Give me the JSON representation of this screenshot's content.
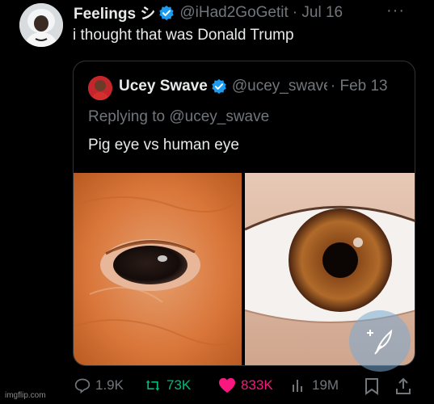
{
  "tweet": {
    "display_name": "Feelings シ",
    "handle": "@iHad2GoGetit",
    "date": "· Jul 16",
    "more_label": "···",
    "text": "i thought that was Donald Trump"
  },
  "quoted": {
    "display_name": "Ucey Swave",
    "handle": "@ucey_swave",
    "date": "· Feb 13",
    "replying_to": "Replying to @ucey_swave",
    "text": "Pig eye vs human eye",
    "images": [
      {
        "icon": "pig-eye-photo"
      },
      {
        "icon": "human-eye-photo"
      }
    ]
  },
  "actions": {
    "replies": "1.9K",
    "retweets": "73K",
    "likes": "833K",
    "views": "19M"
  },
  "colors": {
    "background": "#000000",
    "text": "#e7e9ea",
    "muted": "#71767b",
    "verified": "#1d9bf0",
    "retweet": "#00ba7c",
    "like": "#f91880"
  },
  "watermark": "imgflip.com"
}
